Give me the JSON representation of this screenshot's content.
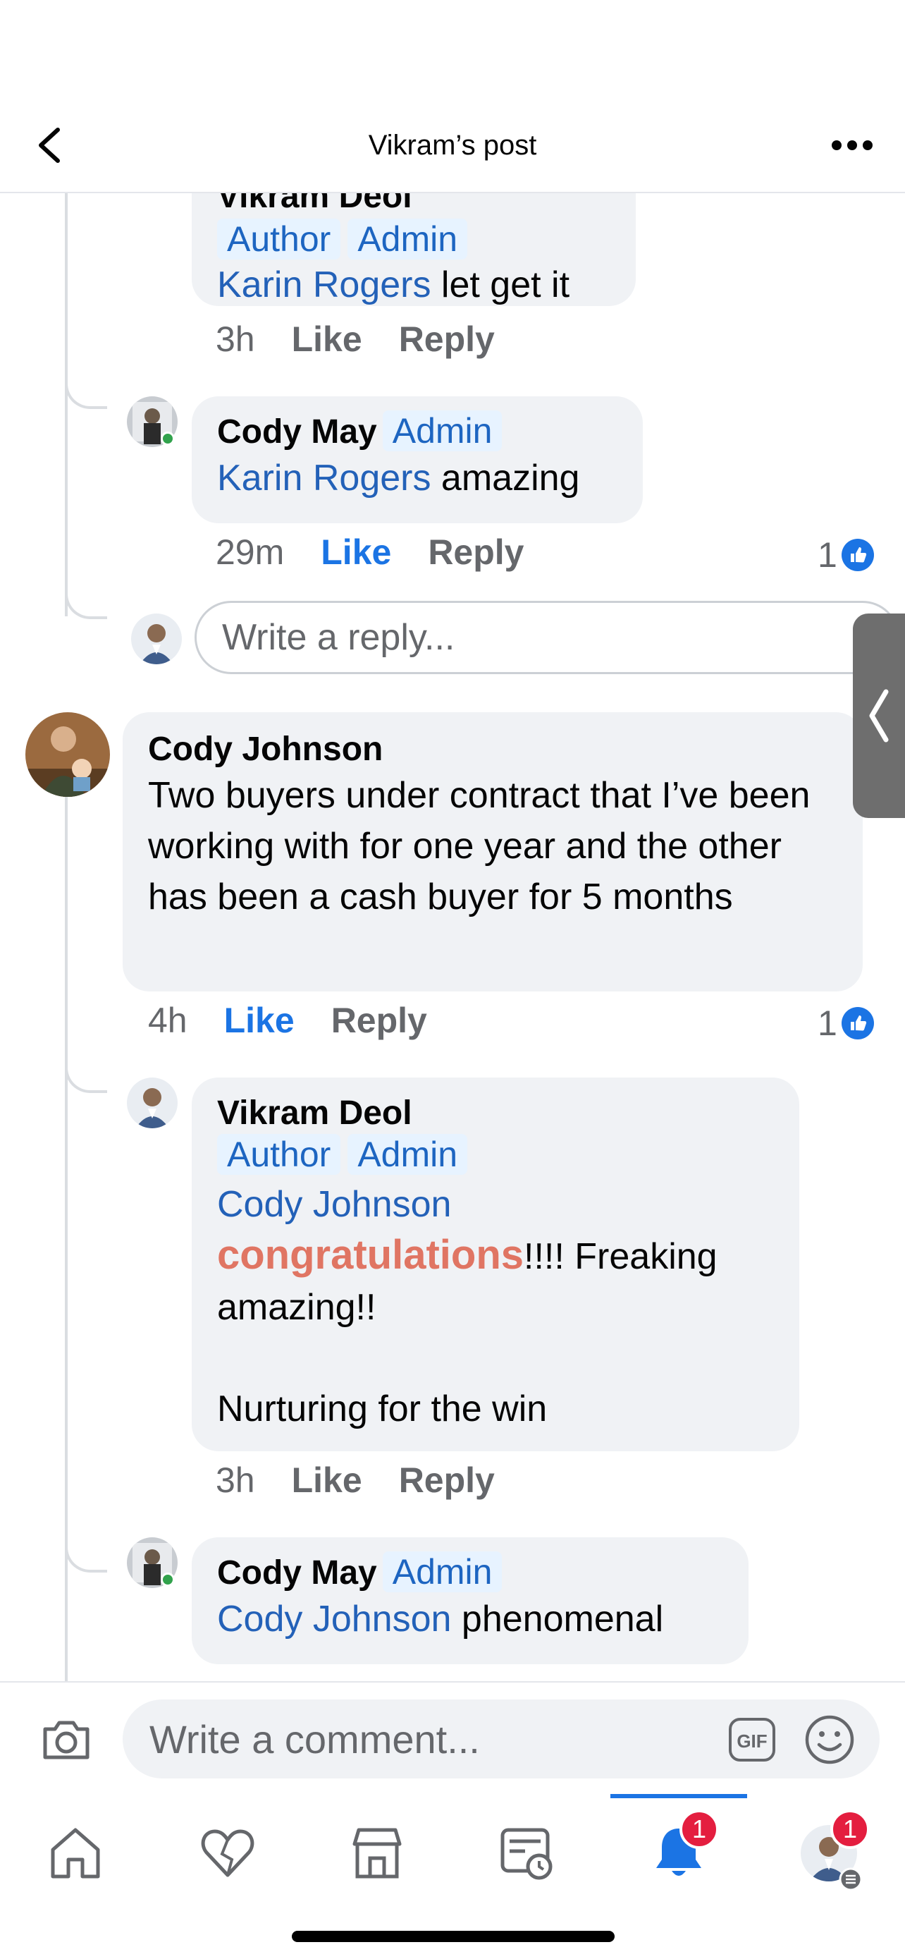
{
  "header": {
    "title": "Vikram’s post"
  },
  "comments": {
    "c1": {
      "author_partial": "Vikram Deol",
      "badges": [
        "Author",
        "Admin"
      ],
      "mention": "Karin Rogers",
      "text": " let get it",
      "time": "3h",
      "like": "Like",
      "reply": "Reply"
    },
    "c2": {
      "author": "Cody May",
      "badge": "Admin",
      "mention": "Karin Rogers",
      "text": " amazing",
      "time": "29m",
      "like": "Like",
      "reply": "Reply",
      "reaction_count": "1"
    },
    "reply_box": {
      "placeholder": "Write a reply..."
    },
    "c3": {
      "author": "Cody Johnson",
      "text": "Two buyers under contract that I’ve been working with for one year and the other has been a cash buyer for 5 months",
      "time": "4h",
      "like": "Like",
      "reply": "Reply",
      "reaction_count": "1"
    },
    "c4": {
      "author": "Vikram Deol",
      "badges": [
        "Author",
        "Admin"
      ],
      "mention": "Cody Johnson",
      "highlight": "congratulations",
      "text_after": "!!!! Freaking amazing!!",
      "text_line2": "Nurturing for the win",
      "time": "3h",
      "like": "Like",
      "reply": "Reply"
    },
    "c5": {
      "author": "Cody May",
      "badge": "Admin",
      "mention": "Cody Johnson",
      "text": " phenomenal"
    }
  },
  "composer": {
    "placeholder": "Write a comment...",
    "gif_label": "GIF"
  },
  "tabbar": {
    "notifications_badge": "1",
    "profile_badge": "1",
    "active_tab": "notifications"
  },
  "colors": {
    "accent": "#1b74e4",
    "mention": "#2361b8",
    "highlight": "#e07563",
    "badge_bg": "#e7f3ff",
    "bubble_bg": "#f0f2f5",
    "notification_red": "#e41e3f",
    "online_green": "#31a24c"
  }
}
